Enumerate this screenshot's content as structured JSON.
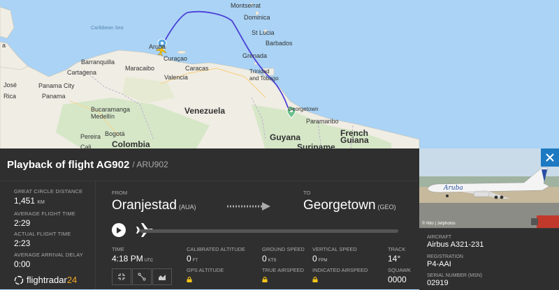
{
  "map": {
    "labels": {
      "montserrat": "Montserrat",
      "dominica": "Dominica",
      "st_lucia": "St Lucia",
      "barbados": "Barbados",
      "grenada": "Grenada",
      "trinidad": "Trinidad\nand Tobago",
      "caribbean_sea": "Caribbean Sea",
      "aruba": "Aruba",
      "curacao": "Curaçao",
      "barranquilla": "Barranquilla",
      "maracaibo": "Maracaibo",
      "caracas": "Caracas",
      "valencia": "Valencia",
      "cartagena": "Cartagena",
      "panama_city": "Panama City",
      "panama": "Panama",
      "jose": "José",
      "rica": "Rica",
      "bucaramanga": "Bucaramanga",
      "venezuela": "Venezuela",
      "medellin": "Medellín",
      "bogota": "Bogotá",
      "pereira": "Pereira",
      "cali": "Cali",
      "colombia": "Colombia",
      "georgetown": "Georgetown",
      "paramaribo": "Paramaribo",
      "guyana": "Guyana",
      "suriname": "Suriname",
      "french_guiana": "French\nGuiana",
      "a": "a"
    }
  },
  "panel": {
    "title": "Playback of flight AG902",
    "subtitle": "/ ARU902"
  },
  "stats": {
    "distance_label": "GREAT CIRCLE DISTANCE",
    "distance_value": "1,451",
    "distance_unit": "KM",
    "avg_time_label": "AVERAGE FLIGHT TIME",
    "avg_time_value": "2:29",
    "actual_time_label": "ACTUAL FLIGHT TIME",
    "actual_time_value": "2:23",
    "delay_label": "AVERAGE ARRIVAL DELAY",
    "delay_value": "0:00"
  },
  "logo": {
    "text": "flightradar",
    "num": "24"
  },
  "route": {
    "from_label": "FROM",
    "from_city": "Oranjestad",
    "from_code": "(AUA)",
    "to_label": "TO",
    "to_city": "Georgetown",
    "to_code": "(GEO)"
  },
  "flightdata": {
    "time_label": "TIME",
    "time_value": "4:18 PM",
    "time_unit": "UTC",
    "cal_alt_label": "CALIBRATED ALTITUDE",
    "cal_alt_value": "0",
    "cal_alt_unit": "FT",
    "gps_alt_label": "GPS ALTITUDE",
    "ground_speed_label": "GROUND SPEED",
    "ground_speed_value": "0",
    "ground_speed_unit": "KTS",
    "true_airspeed_label": "TRUE AIRSPEED",
    "vert_speed_label": "VERTICAL SPEED",
    "vert_speed_value": "0",
    "vert_speed_unit": "FPM",
    "indicated_airspeed_label": "INDICATED AIRSPEED",
    "track_label": "TRACK",
    "track_value": "14°",
    "squawk_label": "SQUAWK",
    "squawk_value": "0000"
  },
  "aircraft": {
    "photo_credit": "© Nito | Jetphotos",
    "livery_text": "Aruba",
    "aircraft_label": "AIRCRAFT",
    "aircraft_value": "Airbus A321-231",
    "registration_label": "REGISTRATION",
    "registration_value": "P4-AAI",
    "serial_label": "SERIAL NUMBER (MSN)",
    "serial_value": "02919"
  },
  "playback": {
    "progress": 0
  },
  "colors": {
    "panel_bg": "#2f2f2f",
    "accent_blue": "#1d7ac2",
    "logo_orange": "#f5a623",
    "track_line": "#4b3fd8"
  },
  "icons": [
    "play-icon",
    "plane-icon",
    "arrow-icon",
    "close-icon",
    "lock-icon",
    "origin-pin-icon",
    "destination-pin-icon"
  ]
}
